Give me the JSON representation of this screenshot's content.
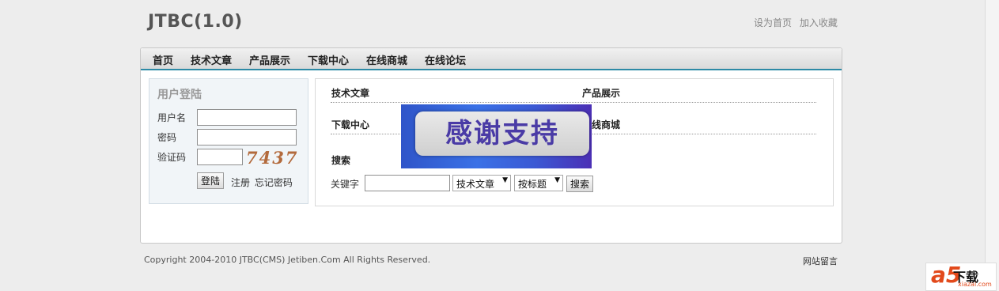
{
  "header": {
    "title": "JTBC(1.0)",
    "links": [
      "设为首页",
      "加入收藏"
    ]
  },
  "nav": {
    "items": [
      "首页",
      "技术文章",
      "产品展示",
      "下载中心",
      "在线商城",
      "在线论坛"
    ]
  },
  "login": {
    "title": "用户登陆",
    "username_label": "用户名",
    "username_value": "",
    "password_label": "密码",
    "password_value": "",
    "captcha_label": "验证码",
    "captcha_value": "",
    "captcha_image_text": "7437",
    "submit_label": "登陆",
    "register_label": "注册",
    "forgot_label": "忘记密码"
  },
  "main": {
    "sections": [
      "技术文章",
      "产品展示",
      "下载中心",
      "在线商城"
    ],
    "search_title": "搜索",
    "keyword_label": "关键字",
    "keyword_value": "",
    "category_selected": "技术文章",
    "field_selected": "按标题",
    "search_button": "搜索"
  },
  "overlay": {
    "text": "感谢支持"
  },
  "footer": {
    "copyright": "Copyright 2004-2010 JTBC(CMS) Jetiben.Com All Rights Reserved.",
    "guestbook": "网站留言"
  },
  "watermark": {
    "brand": "a5",
    "text": "下载",
    "site": "xiazai.com"
  },
  "colors": {
    "nav_accent": "#2d8aa6",
    "overlay_text": "#4a3ba6",
    "watermark_accent": "#e2491b"
  }
}
